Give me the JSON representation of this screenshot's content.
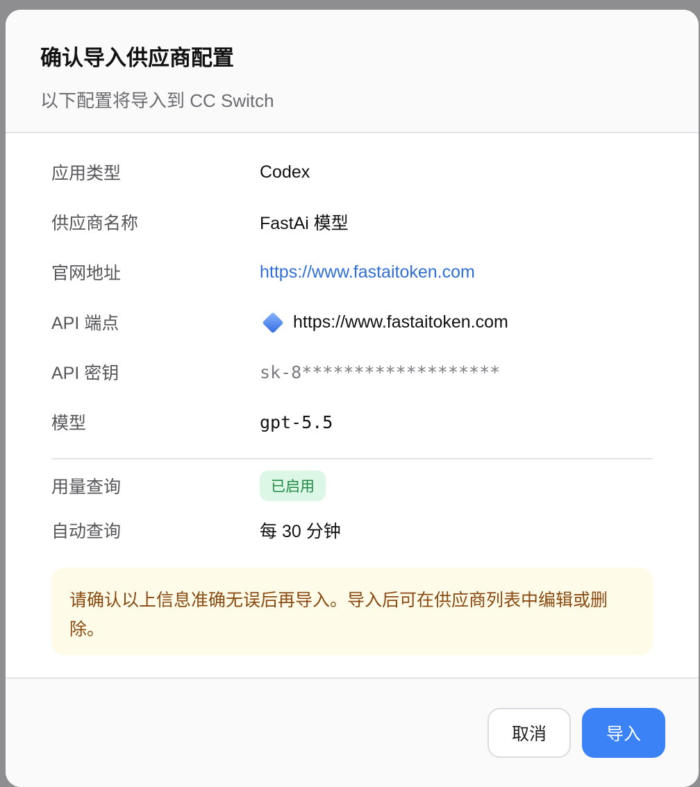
{
  "dialog": {
    "title": "确认导入供应商配置",
    "subtitle": "以下配置将导入到 CC Switch"
  },
  "fields": {
    "app_type_label": "应用类型",
    "app_type_value": "Codex",
    "provider_name_label": "供应商名称",
    "provider_name_value": "FastAi 模型",
    "website_label": "官网地址",
    "website_value": "https://www.fastaitoken.com",
    "endpoint_label": "API 端点",
    "endpoint_value": "https://www.fastaitoken.com",
    "api_key_label": "API 密钥",
    "api_key_value": "sk-8*******************",
    "model_label": "模型",
    "model_value": "gpt-5.5",
    "usage_label": "用量查询",
    "usage_badge": "已启用",
    "auto_query_label": "自动查询",
    "auto_query_value": "每 30 分钟"
  },
  "notice": {
    "text": "请确认以上信息准确无误后再导入。导入后可在供应商列表中编辑或删除。"
  },
  "footer": {
    "cancel_label": "取消",
    "import_label": "导入"
  },
  "colors": {
    "link": "#2f6fd6",
    "primary": "#3b82f6",
    "badge_bg": "#dcf7e6",
    "badge_text": "#1d8a43",
    "notice_bg": "#fefbe8",
    "notice_text": "#8a4a12"
  },
  "icons": {
    "endpoint_icon": "blue-diamond-icon"
  }
}
